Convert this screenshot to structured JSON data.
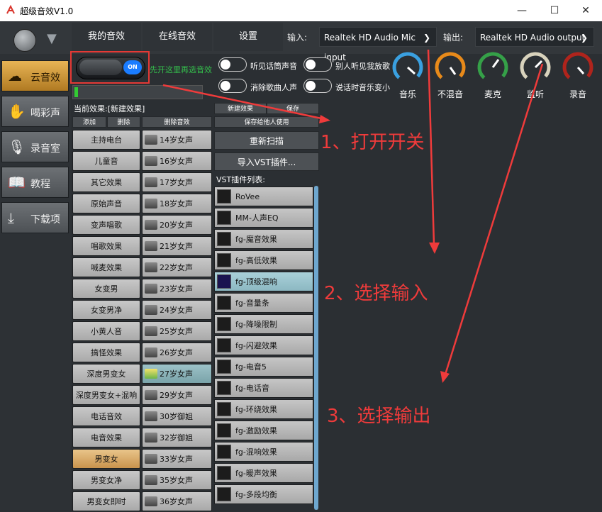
{
  "window": {
    "title": "超级音效V1.0",
    "minimize": "—",
    "maximize": "☐",
    "close": "✕"
  },
  "tabs": [
    {
      "label": "我的音效"
    },
    {
      "label": "在线音效"
    },
    {
      "label": "设置"
    }
  ],
  "io": {
    "input_label": "输入:",
    "input_value": "Realtek HD Audio Mic input",
    "output_label": "输出:",
    "output_value": "Realtek HD Audio output"
  },
  "sidebar": {
    "items": [
      {
        "label": "云音效",
        "icon": "cloud-icon",
        "active": true
      },
      {
        "label": "喝彩声",
        "icon": "hand-icon",
        "active": false
      },
      {
        "label": "录音室",
        "icon": "microphone-icon",
        "active": false
      },
      {
        "label": "教程",
        "icon": "book-icon",
        "active": false
      },
      {
        "label": "下载项",
        "icon": "download-icon",
        "active": false
      }
    ]
  },
  "power": {
    "state_label": "ON",
    "hint": "先开这里再选音效"
  },
  "options": [
    {
      "label": "听见话筒声音"
    },
    {
      "label": "别人听见我放歌"
    },
    {
      "label": "消除歌曲人声"
    },
    {
      "label": "说话时音乐变小"
    }
  ],
  "gauges": [
    {
      "label": "音乐",
      "color": "#3aa0e0"
    },
    {
      "label": "不混音",
      "color": "#e88a1a"
    },
    {
      "label": "麦克",
      "color": "#35a048"
    },
    {
      "label": "监听",
      "color": "#d8d2bc"
    },
    {
      "label": "录音",
      "color": "#b0241c"
    }
  ],
  "level_fraction": 0.03,
  "current_effect": "当前效果:[新建效果]",
  "effect_actions": {
    "add": "添加",
    "delete": "删除",
    "delete_effect": "删除音效"
  },
  "preset_actions": {
    "new": "新建效果",
    "save": "保存",
    "save_share": "保存给他人使用"
  },
  "actions": {
    "rescan": "重新扫描",
    "import_vst": "导入VST插件..."
  },
  "effects_left": [
    {
      "label": "主持电台"
    },
    {
      "label": "儿童音"
    },
    {
      "label": "其它效果"
    },
    {
      "label": "原始声音"
    },
    {
      "label": "变声唱歌"
    },
    {
      "label": "唱歌效果"
    },
    {
      "label": "喊麦效果"
    },
    {
      "label": "女变男"
    },
    {
      "label": "女变男净"
    },
    {
      "label": "小黄人音"
    },
    {
      "label": "搞怪效果"
    },
    {
      "label": "深度男变女"
    },
    {
      "label": "深度男变女+混响"
    },
    {
      "label": "电话音效"
    },
    {
      "label": "电音效果"
    },
    {
      "label": "男变女",
      "selected": true
    },
    {
      "label": "男变女净"
    },
    {
      "label": "男变女即时"
    }
  ],
  "effects_middle": [
    {
      "label": "14岁女声"
    },
    {
      "label": "16岁女声"
    },
    {
      "label": "17岁女声"
    },
    {
      "label": "18岁女声"
    },
    {
      "label": "20岁女声"
    },
    {
      "label": "21岁女声"
    },
    {
      "label": "22岁女声"
    },
    {
      "label": "23岁女声"
    },
    {
      "label": "24岁女声"
    },
    {
      "label": "25岁女声"
    },
    {
      "label": "26岁女声"
    },
    {
      "label": "27岁女声",
      "selected": true
    },
    {
      "label": "29岁女声"
    },
    {
      "label": "30岁御姐"
    },
    {
      "label": "32岁御姐"
    },
    {
      "label": "33岁女声"
    },
    {
      "label": "35岁女声"
    },
    {
      "label": "36岁女声"
    }
  ],
  "vst": {
    "list_label": "VST插件列表:",
    "items": [
      {
        "label": "RoVee"
      },
      {
        "label": "MM-人声EQ"
      },
      {
        "label": "fg-魔音效果"
      },
      {
        "label": "fg-高低效果"
      },
      {
        "label": "fg-顶级混响",
        "selected": true
      },
      {
        "label": "fg-音量条"
      },
      {
        "label": "fg-降噪限制"
      },
      {
        "label": "fg-闪避效果"
      },
      {
        "label": "fg-电音5"
      },
      {
        "label": "fg-电话音"
      },
      {
        "label": "fg-环绕效果"
      },
      {
        "label": "fg-激励效果"
      },
      {
        "label": "fg-混响效果"
      },
      {
        "label": "fg-暖声效果"
      },
      {
        "label": "fg-多段均衡"
      }
    ]
  },
  "annotations": {
    "step1": "1、打开开关",
    "step2": "2、选择输入",
    "step3": "3、选择输出"
  },
  "colors": {
    "annotation": "#ef3b3b",
    "accent": "#1a7cff",
    "hint": "#34c04c",
    "selected_effect": "#d9a860"
  }
}
